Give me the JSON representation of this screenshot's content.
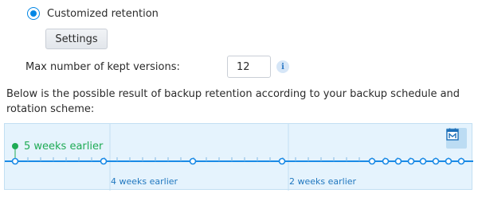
{
  "retention": {
    "option_label": "Customized retention",
    "option_selected": true,
    "settings_button_label": "Settings",
    "max_versions_label": "Max number of kept versions:",
    "max_versions_value": "12",
    "info_icon": "info-icon",
    "description": "Below is the possible result of backup retention according to your backup schedule and rotation scheme:"
  },
  "timeline": {
    "marker_label": "5 weeks earlier",
    "section_labels": [
      "4 weeks earlier",
      "2 weeks earlier"
    ],
    "calendar_icon": "calendar-icon",
    "colors": {
      "line": "#1a8ae6",
      "marker": "#1fab55",
      "label": "#2178c0",
      "background": "#e5f3fd"
    }
  }
}
